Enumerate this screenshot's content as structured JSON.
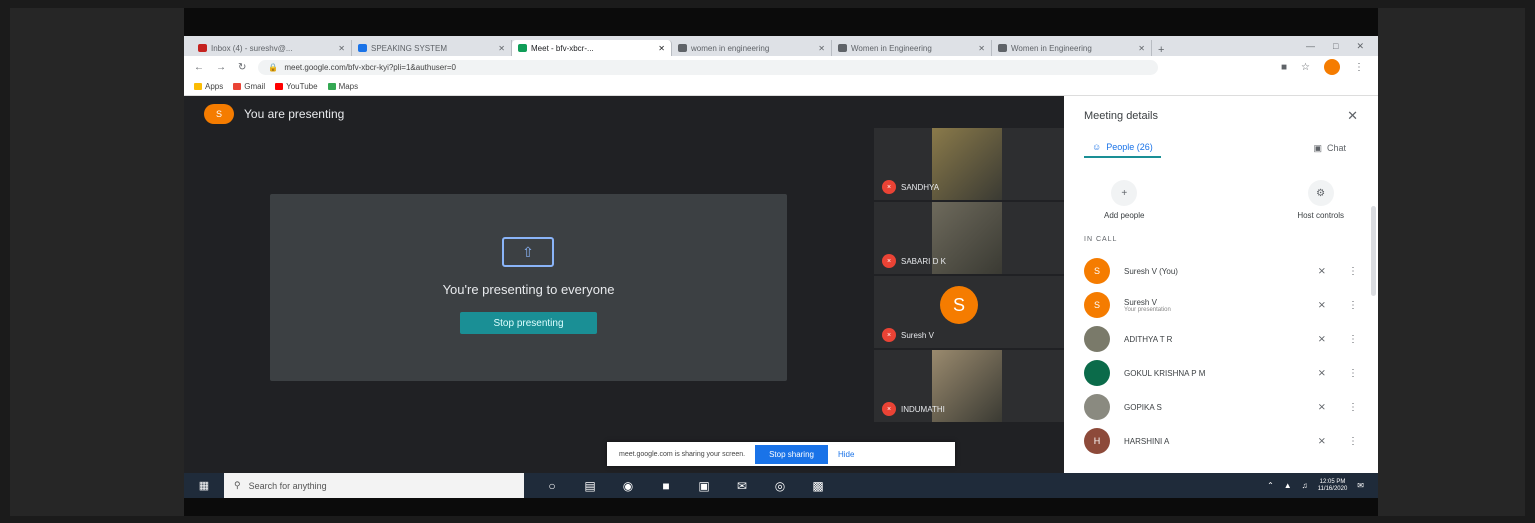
{
  "browser": {
    "tabs": [
      {
        "label": "Inbox (4) - sureshv@...",
        "color": "#c5221f",
        "active": false
      },
      {
        "label": "SPEAKING SYSTEM",
        "color": "#1a73e8",
        "active": false
      },
      {
        "label": "Meet - bfv-xbcr-...",
        "color": "#0f9d58",
        "active": true
      },
      {
        "label": "women in engineering",
        "color": "#5f6368",
        "active": false
      },
      {
        "label": "Women in Engineering",
        "color": "#5f6368",
        "active": false
      },
      {
        "label": "Women in Engineering",
        "color": "#5f6368",
        "active": false
      }
    ],
    "new_tab": "+",
    "url": "meet.google.com/bfv-xbcr-kyi?pli=1&authuser=0",
    "bookmarks": [
      {
        "label": "Apps",
        "color": "#fbbc04"
      },
      {
        "label": "Gmail",
        "color": "#ea4335"
      },
      {
        "label": "YouTube",
        "color": "#ff0000"
      },
      {
        "label": "Maps",
        "color": "#34a853"
      }
    ]
  },
  "meet": {
    "presenter_initial": "S",
    "presenting_label": "You are presenting",
    "presenting_msg": "You're presenting to everyone",
    "stop_presenting": "Stop presenting",
    "tiles": [
      {
        "name": "SANDHYA",
        "type": "video",
        "color": "#8a7a4a"
      },
      {
        "name": "SABARI D K",
        "type": "video",
        "color": "#6e6a5c"
      },
      {
        "name": "Suresh V",
        "type": "avatar",
        "initial": "S"
      },
      {
        "name": "INDUMATHI",
        "type": "video",
        "color": "#9a8a6e"
      }
    ]
  },
  "panel": {
    "title": "Meeting details",
    "tab_people": "People (26)",
    "tab_chat": "Chat",
    "add_people": "Add people",
    "host_controls": "Host controls",
    "in_call": "IN CALL",
    "people": [
      {
        "name": "Suresh V (You)",
        "sub": "",
        "color": "#f57c00",
        "initial": "S"
      },
      {
        "name": "Suresh V",
        "sub": "Your presentation",
        "color": "#f57c00",
        "initial": "S"
      },
      {
        "name": "ADITHYA T R",
        "sub": "",
        "color": "#7a7a6a",
        "initial": ""
      },
      {
        "name": "GOKUL KRISHNA P M",
        "sub": "",
        "color": "#0b6b4a",
        "initial": ""
      },
      {
        "name": "GOPIKA S",
        "sub": "",
        "color": "#8a8a80",
        "initial": ""
      },
      {
        "name": "HARSHINI A",
        "sub": "",
        "color": "#8d4a3a",
        "initial": "H"
      }
    ]
  },
  "share_bar": {
    "message": "meet.google.com is sharing your screen.",
    "stop": "Stop sharing",
    "hide": "Hide"
  },
  "taskbar": {
    "search_placeholder": "Search for anything",
    "time": "12:05 PM",
    "date": "11/16/2020"
  }
}
